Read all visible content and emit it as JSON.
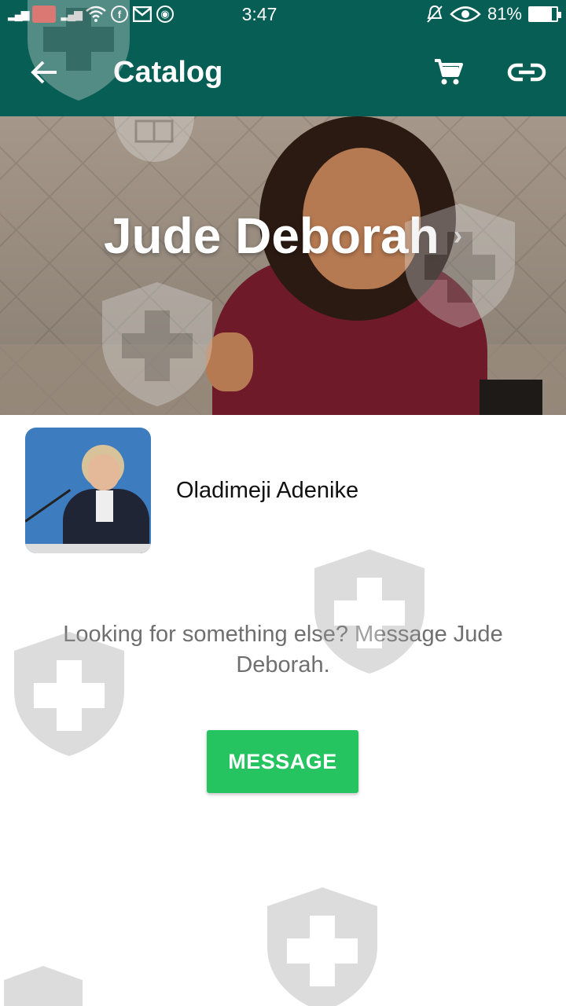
{
  "status_bar": {
    "time": "3:47",
    "battery": "81%",
    "battery_level": 0.81
  },
  "app_bar": {
    "title": "Catalog",
    "icons": [
      "back-arrow-icon",
      "cart-icon",
      "link-icon"
    ]
  },
  "hero": {
    "business_name": "Jude Deborah",
    "chevron": "›"
  },
  "product": {
    "name": "Oladimeji Adenike"
  },
  "empty_prompt": {
    "text": "Looking for something else? Message Jude Deborah.",
    "button_label": "MESSAGE"
  },
  "colors": {
    "primary": "#075e54",
    "accent_button": "#25c461"
  }
}
